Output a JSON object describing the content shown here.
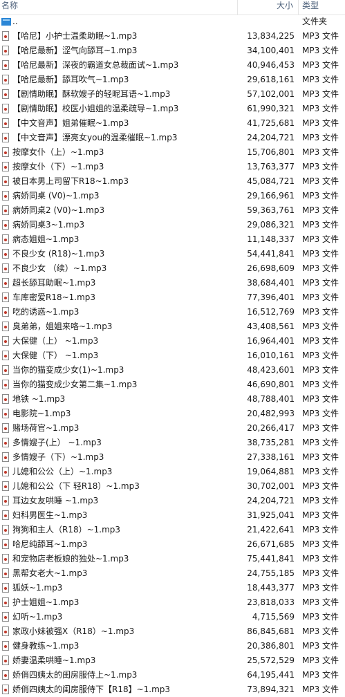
{
  "header": {
    "name_label": "名称",
    "size_label": "大小",
    "type_label": "类型",
    "sort_arrow": "^"
  },
  "parent": {
    "name": "..",
    "type": "文件夹"
  },
  "files": [
    {
      "name": "【哈尼】小护士温柔助眠~1.mp3",
      "size": "13,834,225",
      "type": "MP3 文件"
    },
    {
      "name": "【哈尼最新】涩气向舔耳~1.mp3",
      "size": "34,100,401",
      "type": "MP3 文件"
    },
    {
      "name": "【哈尼最新】深夜的霸道女总裁面试~1.mp3",
      "size": "40,946,453",
      "type": "MP3 文件"
    },
    {
      "name": "【哈尼最新】舔耳吹气~1.mp3",
      "size": "29,618,161",
      "type": "MP3 文件"
    },
    {
      "name": "【剧情助眠】酥软嫂子的轻昵耳语~1.mp3",
      "size": "57,102,001",
      "type": "MP3 文件"
    },
    {
      "name": "【剧情助眠】校医小姐姐的温柔疏导~1.mp3",
      "size": "61,990,321",
      "type": "MP3 文件"
    },
    {
      "name": "【中文音声】姐弟催眠~1.mp3",
      "size": "41,725,681",
      "type": "MP3 文件"
    },
    {
      "name": "【中文音声】漂亮女you的温柔催眠~1.mp3",
      "size": "24,204,721",
      "type": "MP3 文件"
    },
    {
      "name": "按摩女仆（上）~1.mp3",
      "size": "15,706,801",
      "type": "MP3 文件"
    },
    {
      "name": "按摩女仆（下）~1.mp3",
      "size": "13,763,377",
      "type": "MP3 文件"
    },
    {
      "name": "被日本男上司留下R18~1.mp3",
      "size": "45,084,721",
      "type": "MP3 文件"
    },
    {
      "name": "病娇同桌 (V0)~1.mp3",
      "size": "29,166,961",
      "type": "MP3 文件"
    },
    {
      "name": "病娇同桌2 (V0)~1.mp3",
      "size": "59,363,761",
      "type": "MP3 文件"
    },
    {
      "name": "病娇同桌3~1.mp3",
      "size": "29,086,321",
      "type": "MP3 文件"
    },
    {
      "name": "病态姐姐~1.mp3",
      "size": "11,148,337",
      "type": "MP3 文件"
    },
    {
      "name": "不良少女 (R18)~1.mp3",
      "size": "54,441,841",
      "type": "MP3 文件"
    },
    {
      "name": "不良少女 （续）~1.mp3",
      "size": "26,698,609",
      "type": "MP3 文件"
    },
    {
      "name": "超长舔耳助眠~1.mp3",
      "size": "38,684,401",
      "type": "MP3 文件"
    },
    {
      "name": "车库密爱R18~1.mp3",
      "size": "77,396,401",
      "type": "MP3 文件"
    },
    {
      "name": "吃的诱惑~1.mp3",
      "size": "16,512,769",
      "type": "MP3 文件"
    },
    {
      "name": "臭弟弟，姐姐来咯~1.mp3",
      "size": "43,408,561",
      "type": "MP3 文件"
    },
    {
      "name": "大保健（上） ~1.mp3",
      "size": "16,964,401",
      "type": "MP3 文件"
    },
    {
      "name": "大保健（下） ~1.mp3",
      "size": "16,010,161",
      "type": "MP3 文件"
    },
    {
      "name": "当你的猫变成少女(1)~1.mp3",
      "size": "48,423,601",
      "type": "MP3 文件"
    },
    {
      "name": "当你的猫变成少女第二集~1.mp3",
      "size": "46,690,801",
      "type": "MP3 文件"
    },
    {
      "name": "地铁 ~1.mp3",
      "size": "48,788,401",
      "type": "MP3 文件"
    },
    {
      "name": "电影院~1.mp3",
      "size": "20,482,993",
      "type": "MP3 文件"
    },
    {
      "name": "赌场荷官~1.mp3",
      "size": "20,266,417",
      "type": "MP3 文件"
    },
    {
      "name": "多情嫂子(上） ~1.mp3",
      "size": "38,735,281",
      "type": "MP3 文件"
    },
    {
      "name": "多情嫂子（下）~1.mp3",
      "size": "27,338,161",
      "type": "MP3 文件"
    },
    {
      "name": "儿媳和公公（上）~1.mp3",
      "size": "19,064,881",
      "type": "MP3 文件"
    },
    {
      "name": "儿媳和公公（下 轻R18）~1.mp3",
      "size": "30,702,001",
      "type": "MP3 文件"
    },
    {
      "name": "耳边女友哄睡 ~1.mp3",
      "size": "24,204,721",
      "type": "MP3 文件"
    },
    {
      "name": "妇科男医生~1.mp3",
      "size": "31,925,041",
      "type": "MP3 文件"
    },
    {
      "name": "狗狗和主人（R18）~1.mp3",
      "size": "21,422,641",
      "type": "MP3 文件"
    },
    {
      "name": "哈尼纯舔耳~1.mp3",
      "size": "26,671,685",
      "type": "MP3 文件"
    },
    {
      "name": "和宠物店老板娘的独处~1.mp3",
      "size": "75,441,841",
      "type": "MP3 文件"
    },
    {
      "name": "黑帮女老大~1.mp3",
      "size": "24,755,185",
      "type": "MP3 文件"
    },
    {
      "name": "狐妖~1.mp3",
      "size": "18,443,377",
      "type": "MP3 文件"
    },
    {
      "name": "护士姐姐~1.mp3",
      "size": "23,818,033",
      "type": "MP3 文件"
    },
    {
      "name": "幻听~1.mp3",
      "size": "4,715,569",
      "type": "MP3 文件"
    },
    {
      "name": "家政小妹被强X（R18）~1.mp3",
      "size": "86,845,681",
      "type": "MP3 文件"
    },
    {
      "name": "健身教练~1.mp3",
      "size": "20,386,801",
      "type": "MP3 文件"
    },
    {
      "name": "娇妻温柔哄睡~1.mp3",
      "size": "25,572,529",
      "type": "MP3 文件"
    },
    {
      "name": "娇俏四姨太的闺房服侍上~1.mp3",
      "size": "64,195,441",
      "type": "MP3 文件"
    },
    {
      "name": "娇俏四姨太的闺房服侍下【R18】~1.mp3",
      "size": "73,894,321",
      "type": "MP3 文件"
    }
  ]
}
